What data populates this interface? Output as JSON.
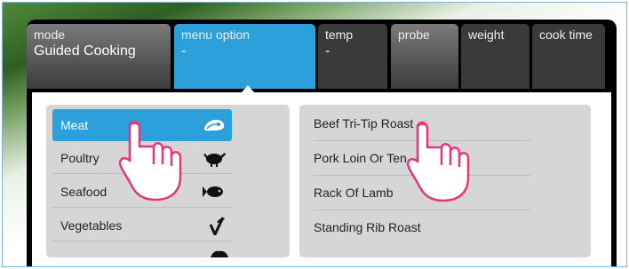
{
  "tabs": [
    {
      "label": "mode",
      "value": "Guided Cooking"
    },
    {
      "label": "menu option",
      "value": "-"
    },
    {
      "label": "temp",
      "value": "-"
    },
    {
      "label": "probe",
      "value": ""
    },
    {
      "label": "weight",
      "value": ""
    },
    {
      "label": "cook time",
      "value": ""
    }
  ],
  "categories": [
    {
      "label": "Meat",
      "icon": "steak-icon",
      "selected": true
    },
    {
      "label": "Poultry",
      "icon": "turkey-icon"
    },
    {
      "label": "Seafood",
      "icon": "fish-icon"
    },
    {
      "label": "Vegetables",
      "icon": "sprout-icon"
    }
  ],
  "recipes": [
    "Beef Tri-Tip Roast",
    "Pork Loin Or Ten",
    "Rack Of Lamb",
    "Standing Rib Roast"
  ],
  "colors": {
    "accent": "#2ba0db",
    "panel": "#000000",
    "list_bg": "#d6d6d6"
  }
}
